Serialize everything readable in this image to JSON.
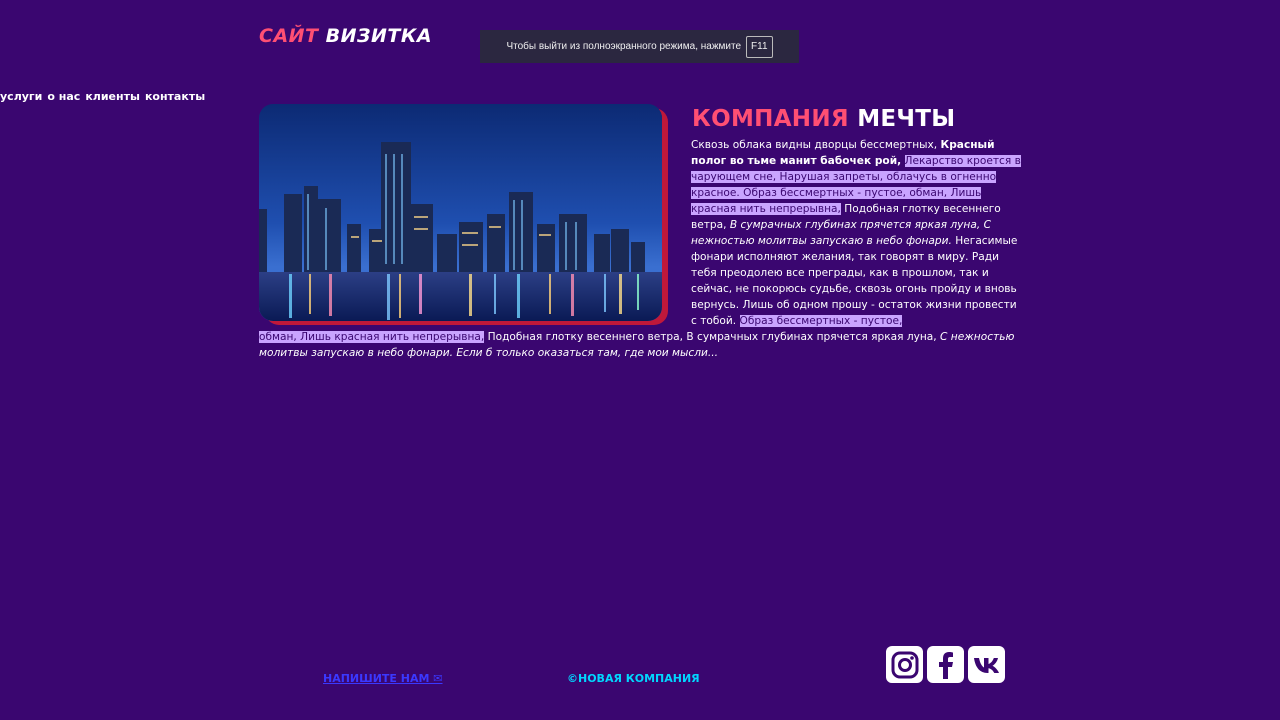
{
  "header": {
    "logo_part1": "САЙТ",
    "logo_part2": "ВИЗИТКА"
  },
  "fullscreen_notice": {
    "text": "Чтобы выйти из полноэкранного режима, нажмите",
    "key": "F11"
  },
  "nav": {
    "items": [
      "услуги",
      "о нас",
      "клиенты",
      "контакты"
    ]
  },
  "hero": {
    "image_icon": "city-skyline-image"
  },
  "article": {
    "title_part1": "КОМПАНИЯ",
    "title_part2": "МЕЧТЫ",
    "s1": "Сквозь облака видны дворцы бессмертных,",
    "s2_bold": "Красный полог во тьме манит бабочек рой,",
    "s3_hl": "Лекарство кроется в чарующем сне, Нарушая запреты, облачусь в огненно красное. Образ бессмертных - пустое, обман, Лишь красная нить непрерывна,",
    "s4": "Подобная глотку весеннего ветра,",
    "s5_it": "В сумрачных глубинах прячется яркая луна, С нежностью молитвы запускаю в небо фонари.",
    "s6": "Негасимые фонари исполняют желания, так говорят в миру. Ради тебя преодолею все преграды, как в прошлом, так и сейчас, не покорюсь судьбе, сквозь огонь пройду и вновь вернусь. Лишь об одном прошу - остаток жизни провести с тобой.",
    "s7_hl_a": "Образ бессмертных - пустое,",
    "s7_hl_b": "обман, Лишь красная нить непрерывна,",
    "s8": "Подобная глотку весеннего ветра, В сумрачных глубинах прячется яркая луна,",
    "s9_it": "С нежностью молитвы запускаю в небо фонари. Если б только оказаться там, где мои мысли..."
  },
  "footer": {
    "link": "НАПИШИТЕ НАМ ✉",
    "copyright": "©НОВАЯ КОМПАНИЯ",
    "socials": [
      "instagram-icon",
      "facebook-icon",
      "vk-icon"
    ]
  },
  "colors": {
    "background": "#3a0670",
    "accent_pink": "#ff4f73",
    "highlight": "#c9a4ff",
    "link_blue": "#3b38ff",
    "copyright_cyan": "#00d7ff"
  }
}
